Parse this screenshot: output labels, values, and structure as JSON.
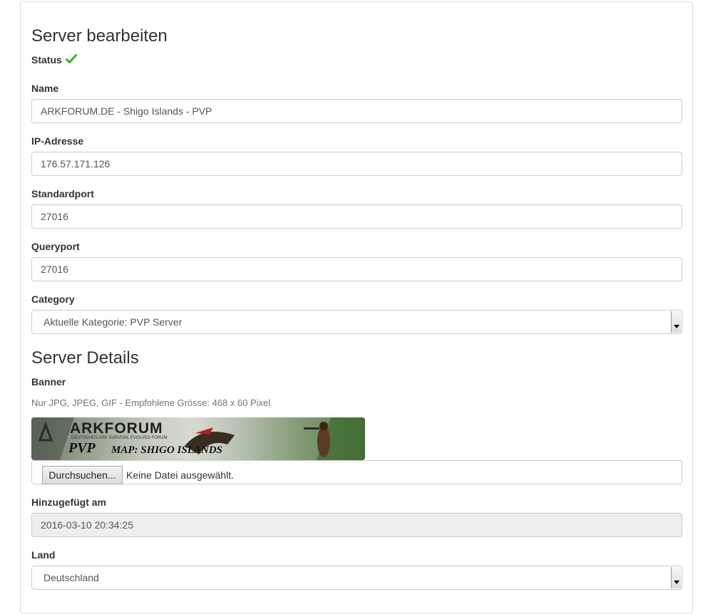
{
  "page": {
    "section_edit_title": "Server bearbeiten",
    "status_label": "Status",
    "status_icon": "check-icon",
    "status_color": "#2eb82e"
  },
  "fields": {
    "name": {
      "label": "Name",
      "value": "ARKFORUM.DE - Shigo Islands - PVP"
    },
    "ip": {
      "label": "IP-Adresse",
      "value": "176.57.171.126"
    },
    "standardport": {
      "label": "Standardport",
      "value": "27016"
    },
    "queryport": {
      "label": "Queryport",
      "value": "27016"
    },
    "category": {
      "label": "Category",
      "value": "Aktuelle Kategorie: PVP Server"
    }
  },
  "details": {
    "title": "Server Details",
    "banner_label": "Banner",
    "banner_help": "Nur JPG, JPEG, GIF - Empfohlene Grösse: 468 x 60 Pixel",
    "banner_image": {
      "brand": "ARKFORUM",
      "tagline": "DEUTSCHES ARK SURVIVAL EVOLVED FORUM",
      "mode": "PVP",
      "map": "MAP: SHIGO ISLANDS"
    },
    "file_button": "Durchsuchen...",
    "file_status": "Keine Datei ausgewählt.",
    "added_label": "Hinzugefügt am",
    "added_value": "2016-03-10 20:34:25",
    "country_label": "Land",
    "country_value": "Deutschland"
  }
}
